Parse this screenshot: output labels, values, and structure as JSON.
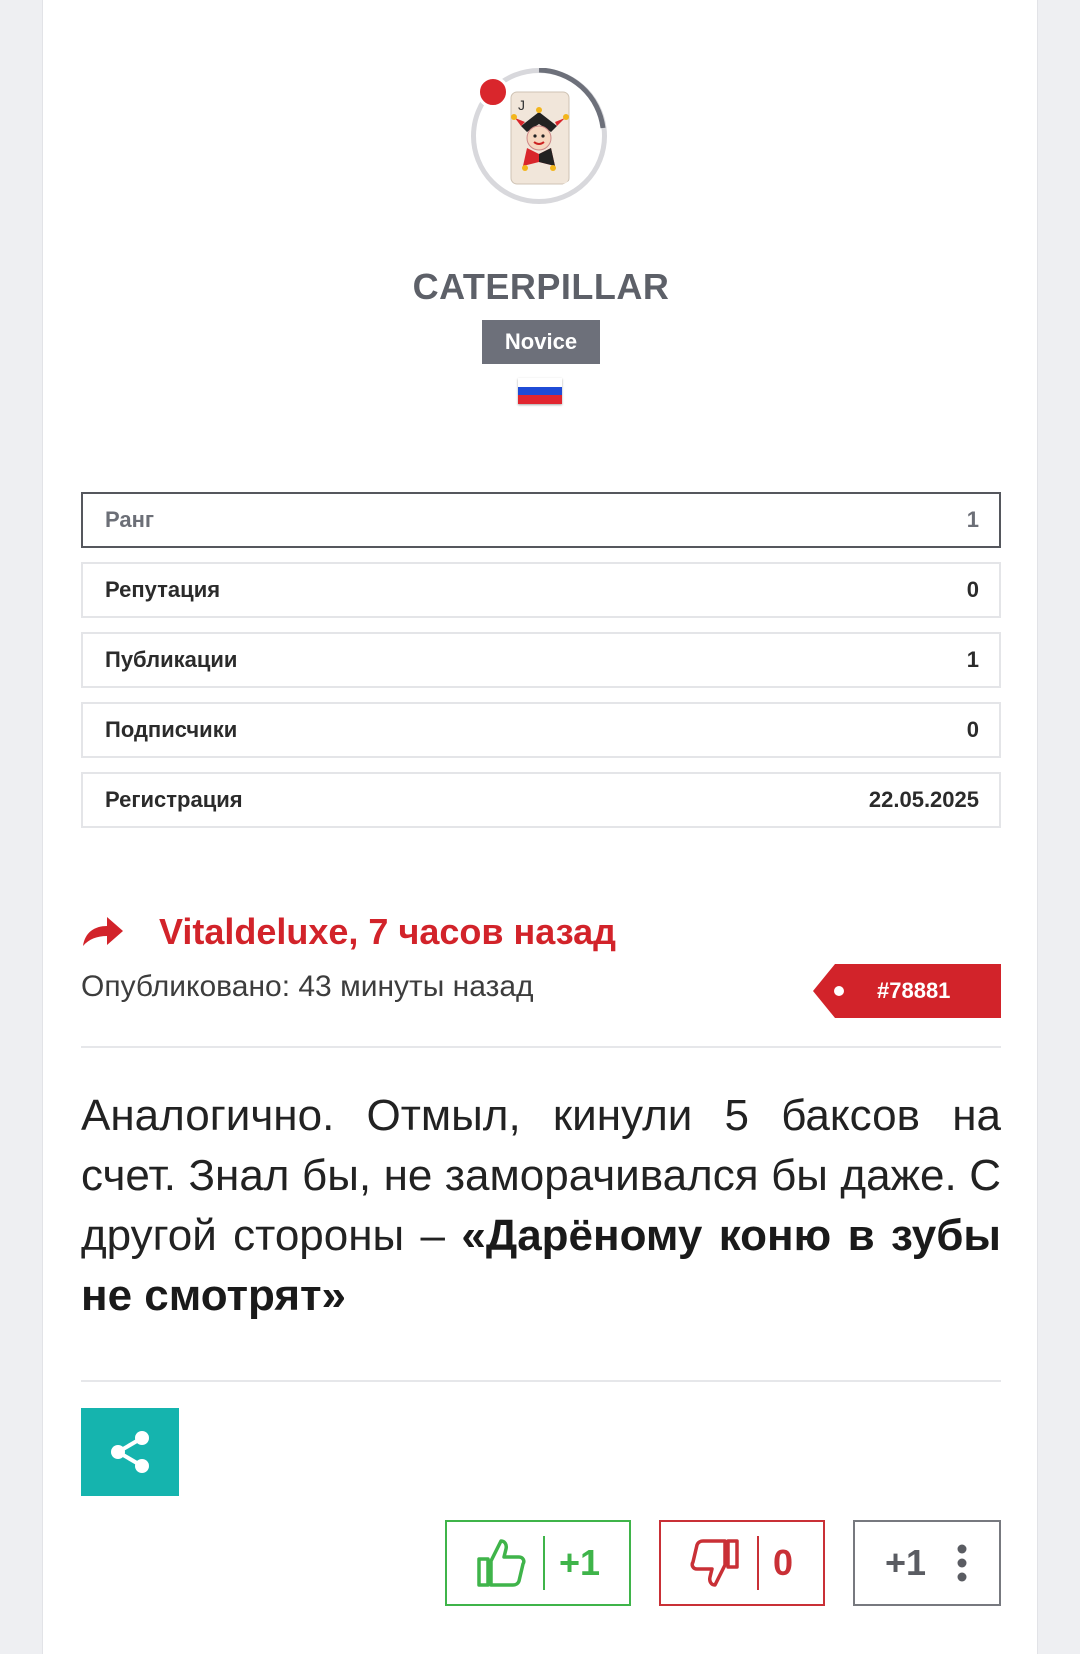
{
  "profile": {
    "username": "CATERPILLAR",
    "rank_badge": "Novice",
    "online": true,
    "flag": "ru-flag-icon"
  },
  "stats": [
    {
      "label": "Ранг",
      "value": "1"
    },
    {
      "label": "Репутация",
      "value": "0"
    },
    {
      "label": "Публикации",
      "value": "1"
    },
    {
      "label": "Подписчики",
      "value": "0"
    },
    {
      "label": "Регистрация",
      "value": "22.05.2025"
    }
  ],
  "post": {
    "reply_to": "Vitaldeluxe, 7 часов назад",
    "published": "Опубликовано: 43 минуты назад",
    "post_number": "#78881",
    "body_text": "Аналогично. Отмыл, кинули 5 баксов на счет. Знал бы, не заморачивался бы даже. С другой стороны – ",
    "body_quote": "«Дарёному коню в зубы не смотрят»"
  },
  "actions": {
    "share_icon": "share-icon",
    "upvote_count": "+1",
    "downvote_count": "0",
    "total_score": "+1"
  },
  "colors": {
    "accent_red": "#d2232a",
    "share_teal": "#15b4ae",
    "upvote_green": "#3fb44a",
    "downvote_red": "#c93036",
    "badge_gray": "#6d707a"
  }
}
